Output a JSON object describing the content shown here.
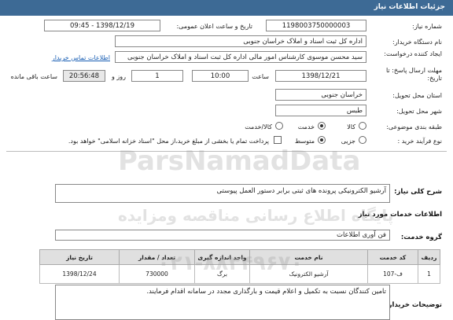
{
  "header": {
    "title": "جزئیات اطلاعات نیاز"
  },
  "fields": {
    "need_number_label": "شماره نیاز:",
    "need_number": "1198003750000003",
    "announce_label": "تاریخ و ساعت اعلان عمومی:",
    "announce_value": "1398/12/19 - 09:45",
    "buyer_org_label": "نام دستگاه خریدار:",
    "buyer_org": "اداره کل ثبت اسناد و املاک خراسان جنوبی",
    "requester_label": "ایجاد کننده درخواست:",
    "requester": "سید محسن موسوی کارشناس امور مالی اداره کل ثبت اسناد و املاک خراسان جنوبی",
    "contact_link": "اطلاعات تماس خریدار",
    "deadline_label": "مهلت ارسال پاسخ: تا تاریخ:",
    "deadline_date": "1398/12/21",
    "time_label": "ساعت",
    "deadline_time": "10:00",
    "days_value": "1",
    "days_label": "روز و",
    "remaining_time": "20:56:48",
    "remaining_label": "ساعت باقی مانده",
    "province_label": "استان محل تحویل:",
    "province": "خراسان جنوبی",
    "city_label": "شهر محل تحویل:",
    "city": "طبس",
    "category_label": "طبقه بندی موضوعی:",
    "category_options": [
      "کالا",
      "خدمت",
      "کالا/خدمت"
    ],
    "process_label": "نوع فرآیند خرید :",
    "process_options": [
      "جزیی",
      "متوسط"
    ],
    "payment_note": "پرداخت تمام یا بخشی از مبلغ خرید،از محل \"اسناد خزانه اسلامی\" خواهد بود."
  },
  "need_summary_label": "شرح کلی نیاز:",
  "need_summary": "آرشیو الکترونیکی پرونده های ثبتی برابر دستور العمل پیوستی",
  "services_title": "اطلاعات خدمات مورد نیاز",
  "service_group_label": "گروه خدمت:",
  "service_group": "فن آوری اطلاعات",
  "table": {
    "headers": [
      "ردیف",
      "کد خدمت",
      "نام خدمت",
      "واحد اندازه گیری",
      "تعداد / مقدار",
      "تاریخ نیاز"
    ],
    "rows": [
      [
        "1",
        "ف-107",
        "آرشیو الکترونیک",
        "برگ",
        "730000",
        "1398/12/24"
      ]
    ]
  },
  "buyer_notes_label": "توضیحات خریدار:",
  "buyer_notes": "تامین کنندگان نسبت به تکمیل و اعلام قیمت و بارگذاری مجدد در سامانه اقدام فرمایند.",
  "watermark": {
    "line1": "ParsNamadData",
    "line2": "پایگاه اطلاع رسانی مناقصه ومزایده",
    "line3": "۰۲۱-۸۸۳۴۹۶۷۰"
  }
}
